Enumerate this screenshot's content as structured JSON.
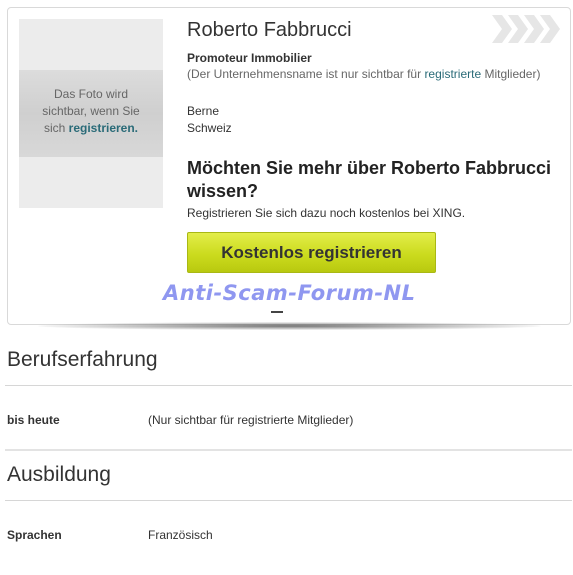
{
  "profile": {
    "name": "Roberto Fabbrucci",
    "job_title": "Promoteur Immobilier",
    "company_note_prefix": "(Der Unternehmensname ist nur sichtbar für ",
    "company_note_link": "registrierte",
    "company_note_suffix": " Mitglieder)",
    "city": "Berne",
    "country": "Schweiz",
    "photo_text_line1": "Das Foto wird",
    "photo_text_line2": "sichtbar, wenn Sie",
    "photo_text_line3_prefix": "sich ",
    "photo_text_line3_link": "registrieren."
  },
  "cta": {
    "heading": "Möchten Sie mehr über Roberto Fabbrucci wissen?",
    "subtext": "Registrieren Sie sich dazu noch kostenlos bei XING.",
    "button_label": "Kostenlos registrieren"
  },
  "watermark": "Anti-Scam-Forum-NL",
  "experience": {
    "title": "Berufserfahrung",
    "rows": [
      {
        "label": "bis heute",
        "value": "(Nur sichtbar für registrierte Mitglieder)"
      }
    ]
  },
  "education": {
    "title": "Ausbildung",
    "rows": [
      {
        "label": "Sprachen",
        "value": "Französisch"
      }
    ]
  },
  "colors": {
    "link": "#2a6b78",
    "button": "#cbdb1e",
    "watermark": "#8f97f0"
  }
}
